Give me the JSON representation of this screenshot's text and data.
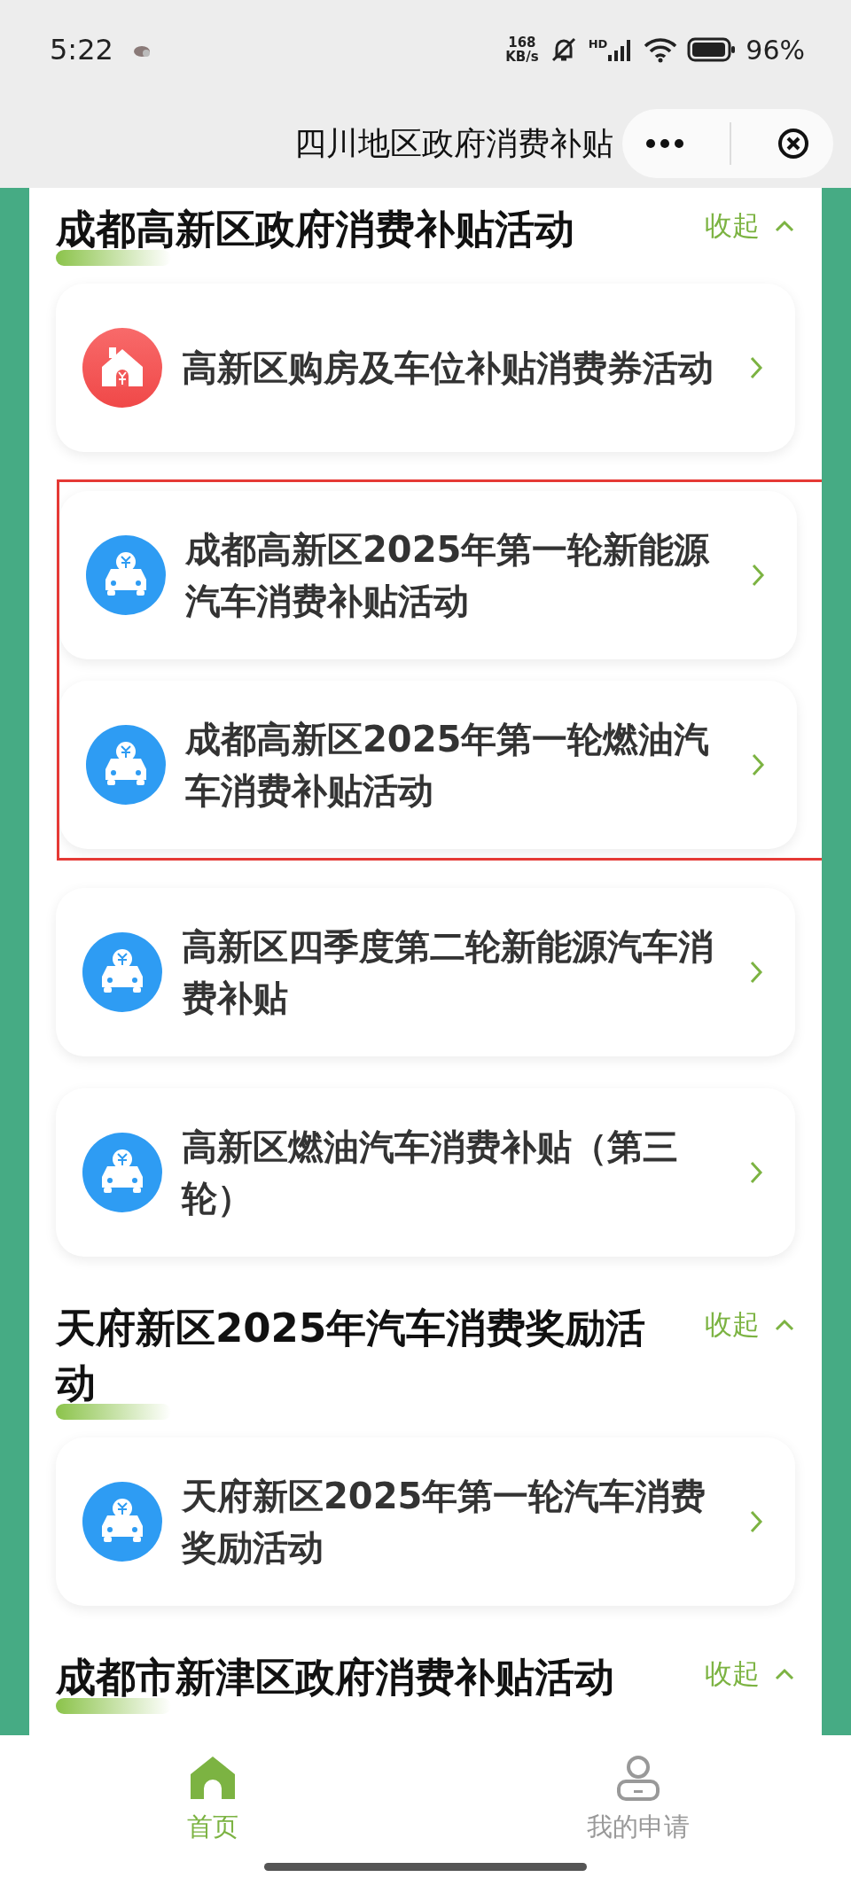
{
  "status_bar": {
    "time": "5:22",
    "speed_value": "168",
    "speed_unit": "KB/s",
    "network": "HD",
    "battery": "96%"
  },
  "header": {
    "title": "四川地区政府消费补贴"
  },
  "sections": [
    {
      "title": "成都高新区政府消费补贴活动",
      "toggle": "收起",
      "expanded": true,
      "items": [
        {
          "kind": "house",
          "label": "高新区购房及车位补贴消费券活动",
          "highlighted": false
        },
        {
          "kind": "car",
          "label": "成都高新区2025年第一轮新能源汽车消费补贴活动",
          "highlighted": true
        },
        {
          "kind": "car",
          "label": "成都高新区2025年第一轮燃油汽车消费补贴活动",
          "highlighted": true
        },
        {
          "kind": "car",
          "label": "高新区四季度第二轮新能源汽车消费补贴",
          "highlighted": false
        },
        {
          "kind": "car",
          "label": "高新区燃油汽车消费补贴（第三轮）",
          "highlighted": false
        }
      ]
    },
    {
      "title": "天府新区2025年汽车消费奖励活动",
      "toggle": "收起",
      "expanded": true,
      "items": [
        {
          "kind": "car",
          "label": "天府新区2025年第一轮汽车消费奖励活动",
          "highlighted": false
        }
      ]
    },
    {
      "title": "成都市新津区政府消费补贴活动",
      "toggle": "收起",
      "expanded": true
    }
  ],
  "tabs": [
    {
      "label": "首页",
      "selected": true
    },
    {
      "label": "我的申请",
      "selected": false
    }
  ]
}
